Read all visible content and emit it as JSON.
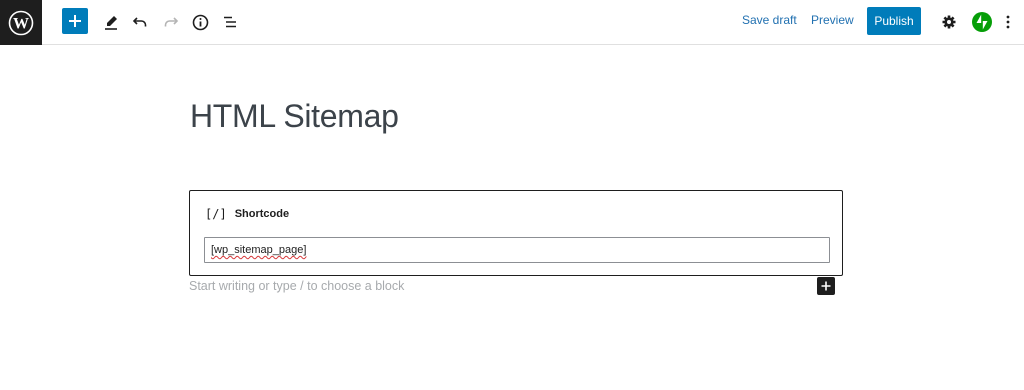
{
  "toolbar": {
    "icons": {
      "logo": "wordpress-logo",
      "add": "plus-icon",
      "tools": "pencil-icon",
      "undo": "undo-icon",
      "redo": "redo-icon",
      "details": "info-icon",
      "list_view": "list-view-icon",
      "settings": "gear-icon",
      "jetpack": "jetpack-icon",
      "options": "more-vertical-icon"
    },
    "save_draft_label": "Save draft",
    "preview_label": "Preview",
    "publish_label": "Publish",
    "colors": {
      "accent": "#007cba",
      "jetpack": "#069e08",
      "logo_bg": "#1e1e1e"
    }
  },
  "editor": {
    "post_title": "HTML Sitemap",
    "block": {
      "icon_glyph": "[/]",
      "label": "Shortcode",
      "value": "[wp_sitemap_page]"
    },
    "placeholder": "Start writing or type / to choose a block"
  }
}
